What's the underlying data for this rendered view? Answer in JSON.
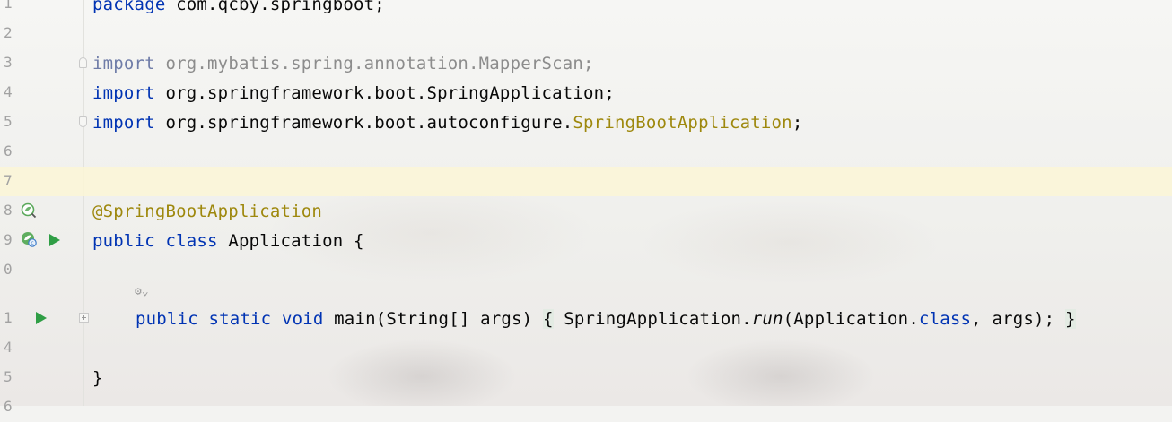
{
  "editor": {
    "colors": {
      "keyword": "#0033b3",
      "annotation": "#9e880d",
      "faded": "#8c8c8c",
      "line_number": "#a2a2a2",
      "run_icon": "#2f9e45",
      "current_line": "#fcf6d6"
    },
    "lines": {
      "l1": {
        "num": "1",
        "kw": "package",
        "rest": " com.qcby.springboot;"
      },
      "l2": {
        "num": "2"
      },
      "l3": {
        "num": "3",
        "kw": "import",
        "rest": " org.mybatis.spring.annotation.MapperScan;"
      },
      "l4": {
        "num": "4",
        "kw": "import",
        "rest": " org.springframework.boot.SpringApplication;"
      },
      "l5": {
        "num": "5",
        "kw": "import",
        "pkg": " org.springframework.boot.autoconfigure.",
        "cls": "SpringBootApplication",
        "end": ";"
      },
      "l6": {
        "num": "6"
      },
      "l7": {
        "num": "7"
      },
      "l8": {
        "num": "8",
        "annotation": "@SpringBootApplication"
      },
      "l9": {
        "num": "9",
        "kw1": "public",
        "kw2": "class",
        "rest": " Application {"
      },
      "l10": {
        "num": "0"
      },
      "l11": {
        "num": "1",
        "kw1": "public",
        "kw2": "static",
        "kw3": "void",
        "sig": " main(String[] args) ",
        "open": "{",
        "call": " SpringApplication.",
        "method": "run",
        "arg1": "(Application.",
        "kwclass": "class",
        "arg2": ", args); ",
        "close": "}"
      },
      "l14": {
        "num": "4"
      },
      "l15": {
        "num": "5",
        "text": "}"
      },
      "l16": {
        "num": "6"
      }
    },
    "inlay_hint": "⚙⌄",
    "icons": [
      "spring-bean-icon",
      "spring-run-icon",
      "run-icon",
      "fold-icon",
      "expand-icon"
    ]
  }
}
